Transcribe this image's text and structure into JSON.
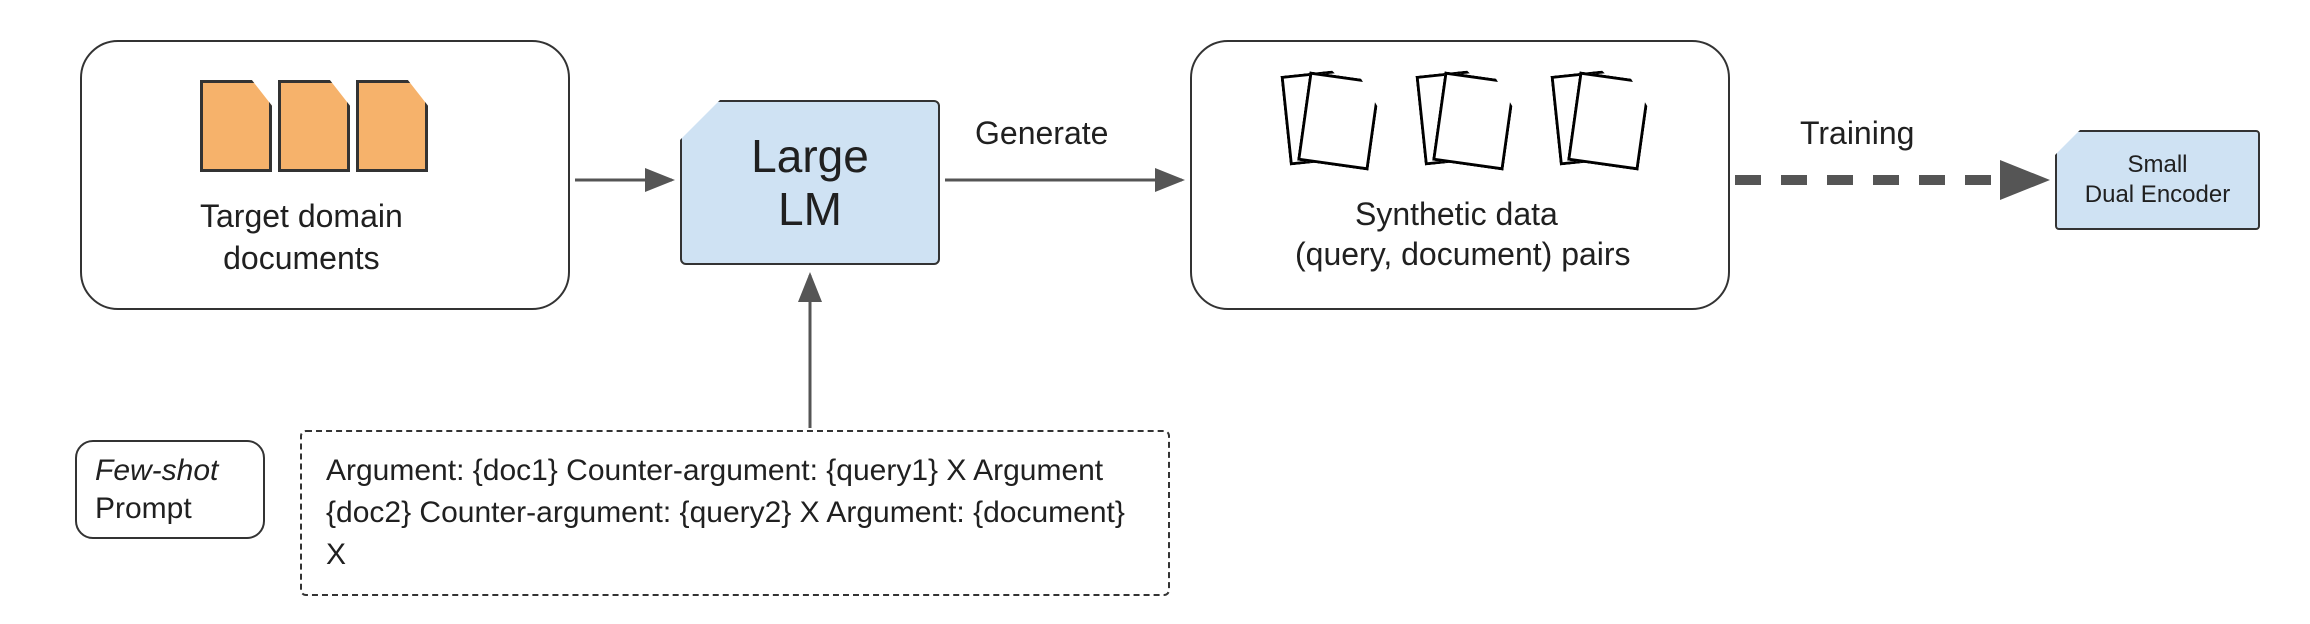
{
  "blocks": {
    "target_docs_label": "Target domain\ndocuments",
    "lm_line1": "Large",
    "lm_line2": "LM",
    "synthetic_line1": "Synthetic data",
    "synthetic_line2": "(query, document) pairs",
    "encoder_line1": "Small",
    "encoder_line2": "Dual Encoder"
  },
  "arrows": {
    "generate": "Generate",
    "training": "Training"
  },
  "prompt": {
    "label_line1": "Few-shot",
    "label_line2": "Prompt",
    "text_line1": "Argument:  {doc1}  Counter-argument:  {query1}  X  Argument",
    "text_line2": "{doc2} Counter-argument: {query2} X Argument: {document} X"
  }
}
